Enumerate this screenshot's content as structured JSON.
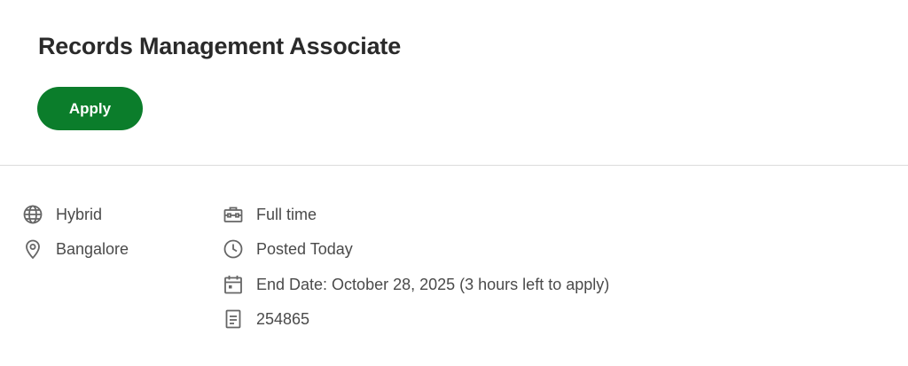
{
  "job": {
    "title": "Records Management Associate",
    "apply_label": "Apply"
  },
  "details_left": [
    {
      "icon": "globe-icon",
      "label": "Hybrid"
    },
    {
      "icon": "location-pin-icon",
      "label": "Bangalore"
    }
  ],
  "details_right": [
    {
      "icon": "briefcase-icon",
      "label": "Full time"
    },
    {
      "icon": "clock-icon",
      "label": "Posted Today"
    },
    {
      "icon": "calendar-icon",
      "label": "End Date: October 28, 2025 (3 hours left to apply)"
    },
    {
      "icon": "document-icon",
      "label": "254865"
    }
  ],
  "colors": {
    "apply_button": "#0b7d2b",
    "divider": "#dcdcdc",
    "icon": "#666666"
  }
}
